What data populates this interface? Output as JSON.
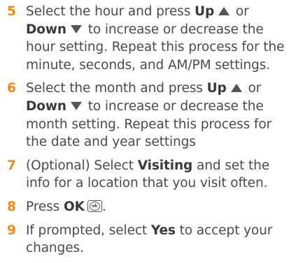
{
  "steps": [
    {
      "number": "5",
      "t1": "Select the hour and press ",
      "kw1": "Up",
      "t2": " or ",
      "kw2": "Down",
      "t3": " to increase or decrease the hour setting. Repeat this process for the minute, seconds, and AM/PM settings."
    },
    {
      "number": "6",
      "t1": "Select the month and press ",
      "kw1": "Up",
      "t2": " or ",
      "kw2": "Down",
      "t3": " to increase or decrease the month setting. Repeat this process for the date and year settings"
    },
    {
      "number": "7",
      "t1": "(Optional) Select ",
      "kw1": "Visiting",
      "t2": " and set the info for a location that you visit often."
    },
    {
      "number": "8",
      "t1": "Press ",
      "kw1": "OK",
      "t2": ".",
      "key_label": "ok"
    },
    {
      "number": "9",
      "t1": "If prompted, select ",
      "kw1": "Yes",
      "t2": " to accept your changes."
    }
  ],
  "icons": {
    "up": "up-arrow-icon",
    "down": "down-arrow-icon",
    "ok": "ok-key-icon"
  },
  "colors": {
    "step_number": "#f08a1c",
    "text": "#4a4a4a"
  }
}
